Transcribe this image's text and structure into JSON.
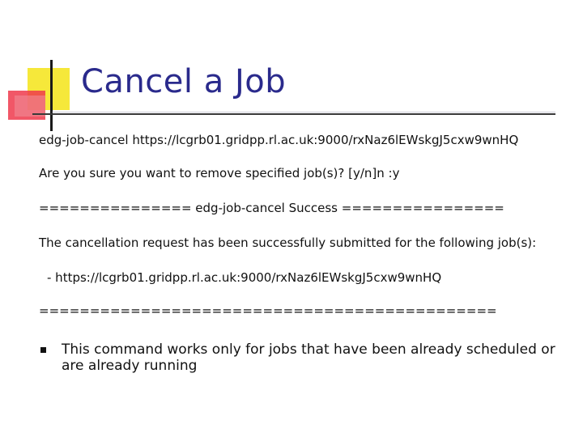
{
  "slide": {
    "title": "Cancel a Job",
    "lines": [
      "edg-job-cancel https://lcgrb01.gridpp.rl.ac.uk:9000/rxNaz6lEWskgJ5cxw9wnHQ",
      "Are you sure you want to remove specified job(s)? [y/n]n :y",
      "===============  edg-job-cancel Success  ================",
      "The cancellation request has been successfully submitted for the following job(s):",
      "- https://lcgrb01.gridpp.rl.ac.uk:9000/rxNaz6lEWskgJ5cxw9wnHQ",
      "============================================="
    ],
    "bullets": [
      "This command works only for jobs that have been already scheduled or are already running"
    ],
    "colors": {
      "title": "#2a2a8c",
      "logo_yellow": "#f6e83a",
      "logo_red": "#ee3a4c"
    }
  }
}
